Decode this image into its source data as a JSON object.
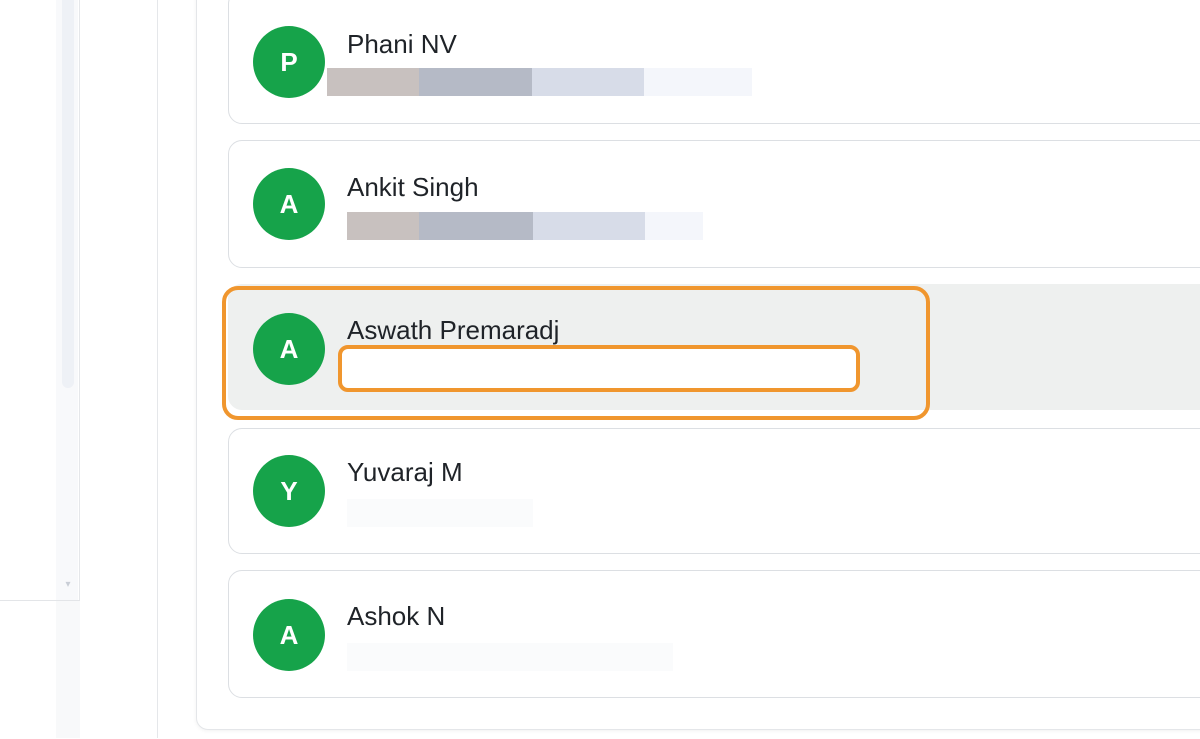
{
  "contacts": [
    {
      "initial": "P",
      "name": "Phani NV",
      "selected": false
    },
    {
      "initial": "A",
      "name": "Ankit Singh",
      "selected": false
    },
    {
      "initial": "A",
      "name": "Aswath Premaradj",
      "selected": true
    },
    {
      "initial": "Y",
      "name": "Yuvaraj M",
      "selected": false
    },
    {
      "initial": "A",
      "name": "Ashok N",
      "selected": false
    }
  ],
  "colors": {
    "avatar": "#16a34a",
    "highlight": "#f0962e",
    "selected_bg": "#eef0ef"
  }
}
